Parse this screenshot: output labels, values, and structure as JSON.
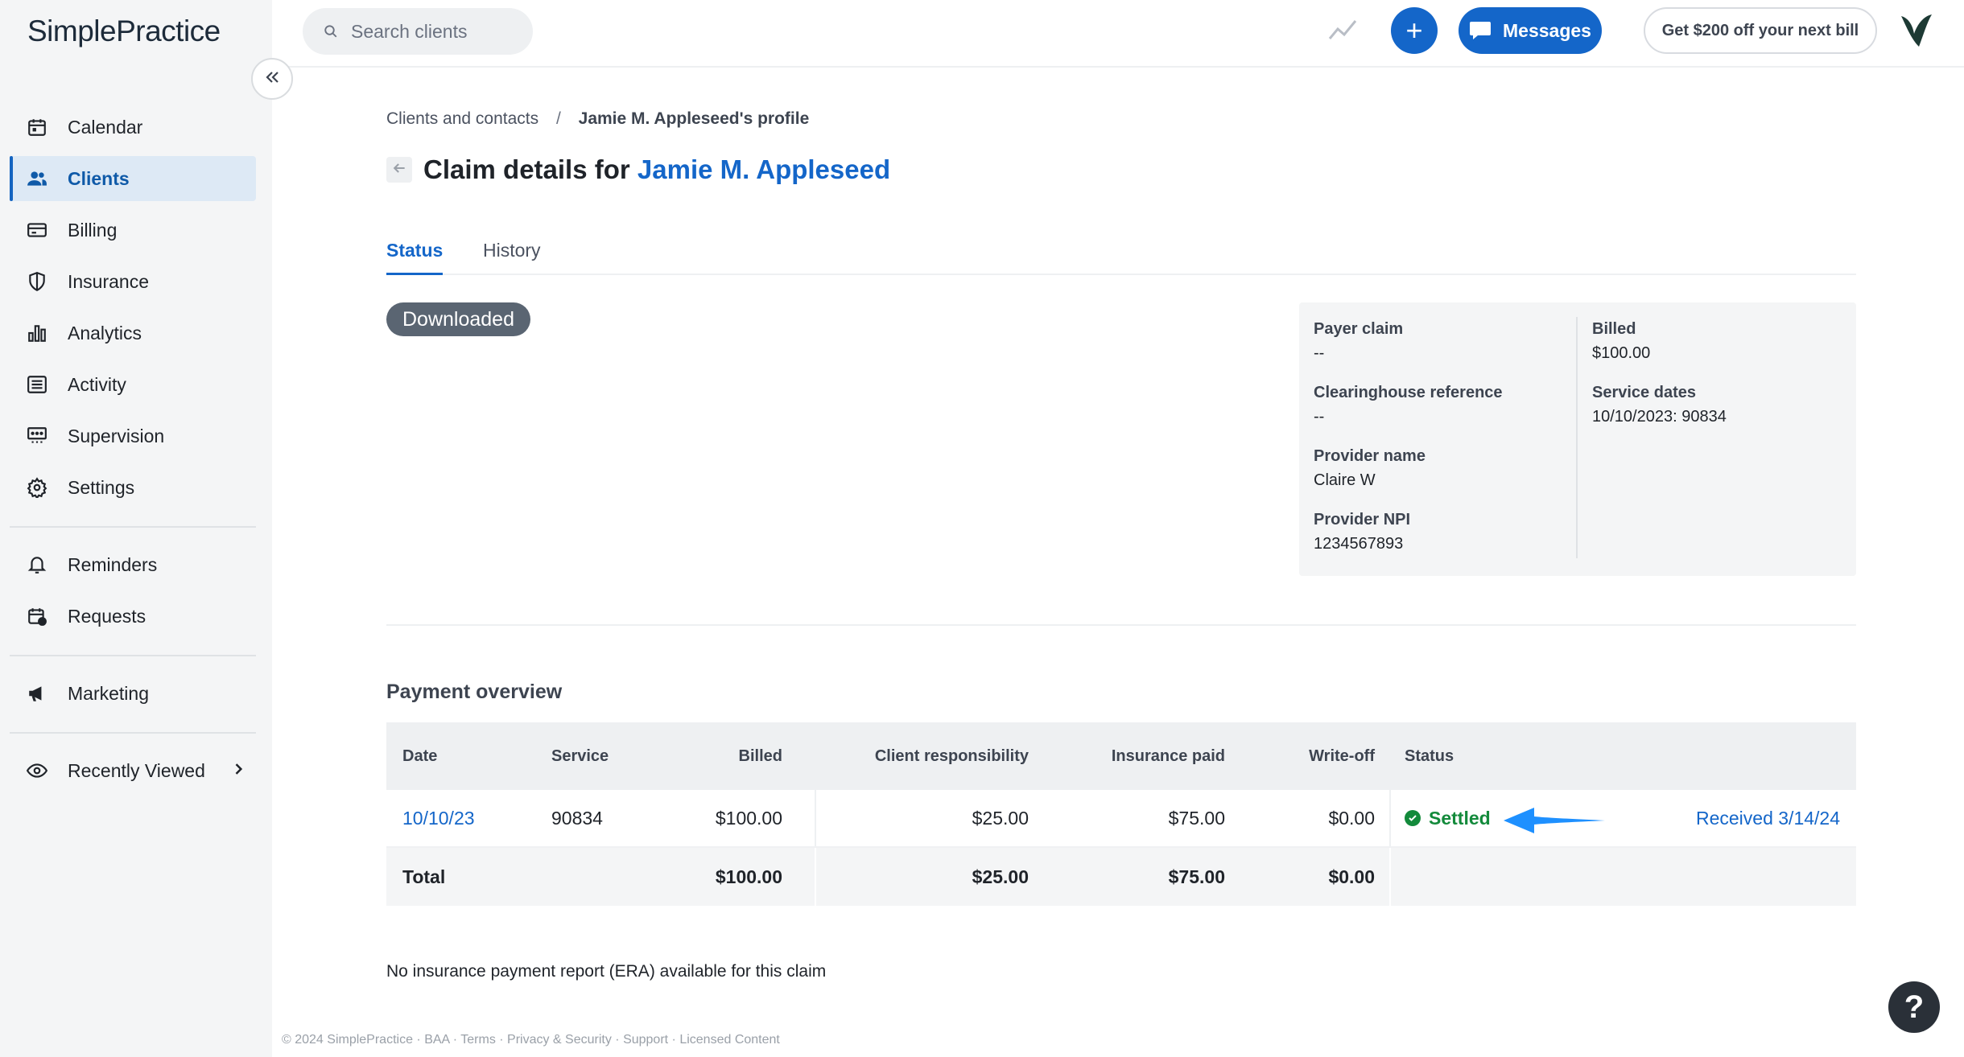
{
  "brand": {
    "name": "SimplePractice"
  },
  "sidebar": {
    "items": [
      {
        "label": "Calendar",
        "icon": "calendar-icon"
      },
      {
        "label": "Clients",
        "icon": "users-icon"
      },
      {
        "label": "Billing",
        "icon": "credit-card-icon"
      },
      {
        "label": "Insurance",
        "icon": "shield-icon"
      },
      {
        "label": "Analytics",
        "icon": "bar-chart-icon"
      },
      {
        "label": "Activity",
        "icon": "list-icon"
      },
      {
        "label": "Supervision",
        "icon": "supervision-icon"
      },
      {
        "label": "Settings",
        "icon": "gear-icon"
      }
    ],
    "secondary": [
      {
        "label": "Reminders",
        "icon": "bell-icon"
      },
      {
        "label": "Requests",
        "icon": "calendar-request-icon"
      }
    ],
    "marketing": {
      "label": "Marketing",
      "icon": "megaphone-icon"
    },
    "recent": {
      "label": "Recently Viewed",
      "icon": "eye-icon"
    },
    "active_item": "Clients"
  },
  "header": {
    "search_placeholder": "Search clients",
    "messages_label": "Messages",
    "promo_label": "Get $200 off your next bill",
    "plus_label": "+"
  },
  "breadcrumb": {
    "parent": "Clients and contacts",
    "separator": "/",
    "current": "Jamie M. Appleseed's profile"
  },
  "page": {
    "title_prefix": "Claim details for ",
    "client_name": "Jamie M. Appleseed"
  },
  "tabs": [
    {
      "label": "Status",
      "active": true
    },
    {
      "label": "History",
      "active": false
    }
  ],
  "claim_status": "Downloaded",
  "claim_details": {
    "payer_claim": {
      "label": "Payer claim",
      "value": "--"
    },
    "clearinghouse_reference": {
      "label": "Clearinghouse reference",
      "value": "--"
    },
    "provider_name": {
      "label": "Provider name",
      "value": "Claire W"
    },
    "provider_npi": {
      "label": "Provider NPI",
      "value": "1234567893"
    },
    "billed": {
      "label": "Billed",
      "value": "$100.00"
    },
    "service_dates": {
      "label": "Service dates",
      "value": "10/10/2023: 90834"
    }
  },
  "payment_overview": {
    "title": "Payment overview",
    "columns": [
      "Date",
      "Service",
      "Billed",
      "Client responsibility",
      "Insurance paid",
      "Write-off",
      "Status"
    ],
    "rows": [
      {
        "date": "10/10/23",
        "service": "90834",
        "billed": "$100.00",
        "client_responsibility": "$25.00",
        "insurance_paid": "$75.00",
        "write_off": "$0.00",
        "status": "Settled",
        "received": "Received 3/14/24"
      }
    ],
    "total": {
      "label": "Total",
      "billed": "$100.00",
      "client_responsibility": "$25.00",
      "insurance_paid": "$75.00",
      "write_off": "$0.00"
    }
  },
  "era_note": "No insurance payment report (ERA) available for this claim",
  "footer": "© 2024 SimplePractice · BAA · Terms · Privacy & Security · Support · Licensed Content",
  "help_label": "?",
  "colors": {
    "primary": "#1466c9",
    "settled_green": "#138a3b",
    "status_pill": "#5a6572",
    "annotation_arrow": "#1e90ff"
  }
}
